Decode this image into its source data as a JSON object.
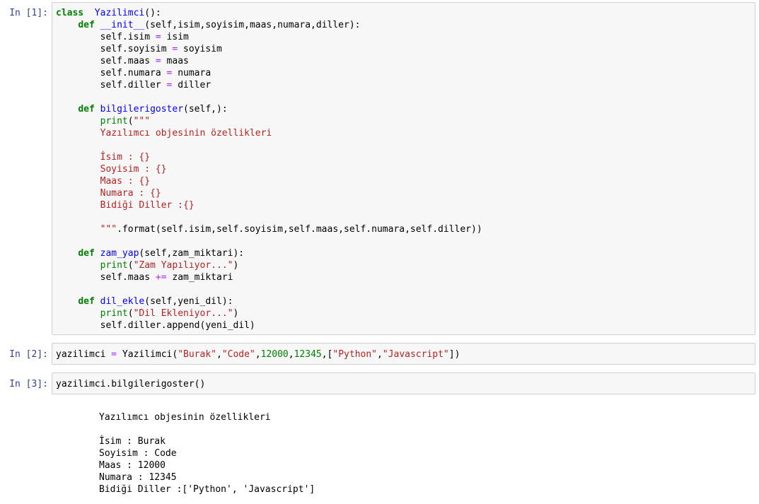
{
  "cells": [
    {
      "prompt": "In [1]:",
      "lines": [
        [
          [
            "kw",
            "class"
          ],
          [
            "",
            "  "
          ],
          [
            "fn",
            "Yazilimci"
          ],
          [
            "",
            "():"
          ]
        ],
        [
          [
            "",
            "    "
          ],
          [
            "kw",
            "def"
          ],
          [
            "",
            ""
          ],
          [
            "fn",
            " __init__"
          ],
          [
            "",
            "(self,isim,soyisim,maas,numara,diller):"
          ]
        ],
        [
          [
            "",
            "        self.isim "
          ],
          [
            "op",
            "="
          ],
          [
            "",
            " isim"
          ]
        ],
        [
          [
            "",
            "        self.soyisim "
          ],
          [
            "op",
            "="
          ],
          [
            "",
            " soyisim"
          ]
        ],
        [
          [
            "",
            "        self.maas "
          ],
          [
            "op",
            "="
          ],
          [
            "",
            " maas"
          ]
        ],
        [
          [
            "",
            "        self.numara "
          ],
          [
            "op",
            "="
          ],
          [
            "",
            " numara"
          ]
        ],
        [
          [
            "",
            "        self.diller "
          ],
          [
            "op",
            "="
          ],
          [
            "",
            " diller"
          ]
        ],
        [
          [
            "",
            ""
          ]
        ],
        [
          [
            "",
            "    "
          ],
          [
            "kw",
            "def"
          ],
          [
            "",
            ""
          ],
          [
            "fn",
            " bilgilerigoster"
          ],
          [
            "",
            "(self,):"
          ]
        ],
        [
          [
            "",
            "        "
          ],
          [
            "bi",
            "print"
          ],
          [
            "",
            "("
          ],
          [
            "str",
            "\"\"\""
          ]
        ],
        [
          [
            "str",
            "        Yazılımcı objesinin özellikleri"
          ]
        ],
        [
          [
            "",
            ""
          ]
        ],
        [
          [
            "str",
            "        İsim : {}"
          ]
        ],
        [
          [
            "str",
            "        Soyisim : {}"
          ]
        ],
        [
          [
            "str",
            "        Maas : {}"
          ]
        ],
        [
          [
            "str",
            "        Numara : {}"
          ]
        ],
        [
          [
            "str",
            "        Bidiği Diller :{}"
          ]
        ],
        [
          [
            "",
            ""
          ]
        ],
        [
          [
            "str",
            "        \"\"\""
          ],
          [
            "",
            "."
          ],
          [
            "",
            "format(self.isim,self.soyisim,self.maas,self.numara,self.diller))"
          ]
        ],
        [
          [
            "",
            ""
          ]
        ],
        [
          [
            "",
            "    "
          ],
          [
            "kw",
            "def"
          ],
          [
            "",
            ""
          ],
          [
            "fn",
            " zam_yap"
          ],
          [
            "",
            "(self,zam_miktari):"
          ]
        ],
        [
          [
            "",
            "        "
          ],
          [
            "bi",
            "print"
          ],
          [
            "",
            "("
          ],
          [
            "str",
            "\"Zam Yapılıyor...\""
          ],
          [
            "",
            ")"
          ]
        ],
        [
          [
            "",
            "        self.maas "
          ],
          [
            "op",
            "+="
          ],
          [
            "",
            " zam_miktari"
          ]
        ],
        [
          [
            "",
            ""
          ]
        ],
        [
          [
            "",
            "    "
          ],
          [
            "kw",
            "def"
          ],
          [
            "",
            ""
          ],
          [
            "fn",
            " dil_ekle"
          ],
          [
            "",
            "(self,yeni_dil):"
          ]
        ],
        [
          [
            "",
            "        "
          ],
          [
            "bi",
            "print"
          ],
          [
            "",
            "("
          ],
          [
            "str",
            "\"Dil Ekleniyor...\""
          ],
          [
            "",
            ")"
          ]
        ],
        [
          [
            "",
            "        self.diller.append(yeni_dil)"
          ]
        ]
      ]
    },
    {
      "prompt": "In [2]:",
      "lines": [
        [
          [
            "",
            "yazilimci "
          ],
          [
            "op",
            "="
          ],
          [
            "",
            " Yazilimci("
          ],
          [
            "str",
            "\"Burak\""
          ],
          [
            "",
            ","
          ],
          [
            "str",
            "\"Code\""
          ],
          [
            "",
            ","
          ],
          [
            "num",
            "12000"
          ],
          [
            "",
            ","
          ],
          [
            "num",
            "12345"
          ],
          [
            "",
            ",["
          ],
          [
            "str",
            "\"Python\""
          ],
          [
            "",
            ","
          ],
          [
            "str",
            "\"Javascript\""
          ],
          [
            "",
            "])"
          ]
        ]
      ]
    },
    {
      "prompt": "In [3]:",
      "lines": [
        [
          [
            "",
            "yazilimci.bilgilerigoster()"
          ]
        ]
      ]
    }
  ],
  "output": {
    "lines": [
      "Yazılımcı objesinin özellikleri",
      "",
      "İsim : Burak",
      "Soyisim : Code",
      "Maas : 12000",
      "Numara : 12345",
      "Bidiği Diller :['Python', 'Javascript']"
    ]
  }
}
